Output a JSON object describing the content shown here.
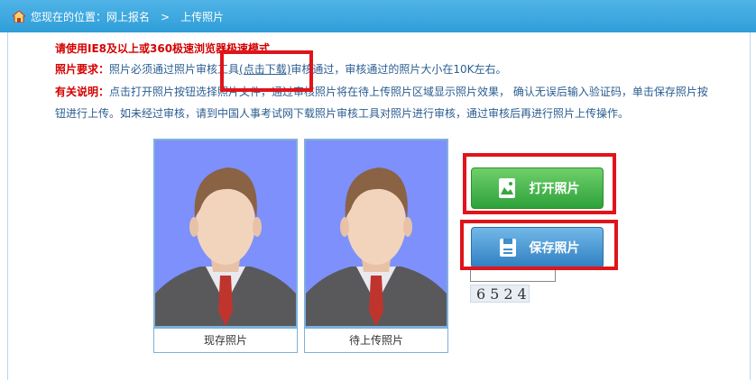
{
  "breadcrumb": {
    "prefix": "您现在的位置：网上报名",
    "separator": ">",
    "current": "上传照片"
  },
  "notice": "请使用IE8及以上或360极速浏览器极速模式",
  "requirement": {
    "label": "照片要求：",
    "text_before": "照片必须通过照片审核工具",
    "link": "(点击下载)",
    "text_after": "审核通过，审核通过的照片大小在10K左右。"
  },
  "instructions": {
    "label": "有关说明：",
    "line1": "点击打开照片按钮选择照片文件，通过审核照片将在待上传照片区域显示照片效果， 确认无误后输入验证码，单击保存照片按",
    "line2": "钮进行上传。如未经过审核，请到中国人事考试网下载照片审核工具对照片进行审核，通过审核后再进行照片上传操作。"
  },
  "photos": {
    "current_caption": "现存照片",
    "pending_caption": "待上传照片"
  },
  "buttons": {
    "open_label": "打开照片",
    "save_label": "保存照片"
  },
  "captcha": {
    "input_value": "",
    "code": "6524"
  },
  "colors": {
    "topbar": "#3aa7df",
    "photo_bg": "#7d90fb",
    "highlight": "#e0141a",
    "open_button": "#3fb447",
    "save_button": "#3c8fd0"
  }
}
